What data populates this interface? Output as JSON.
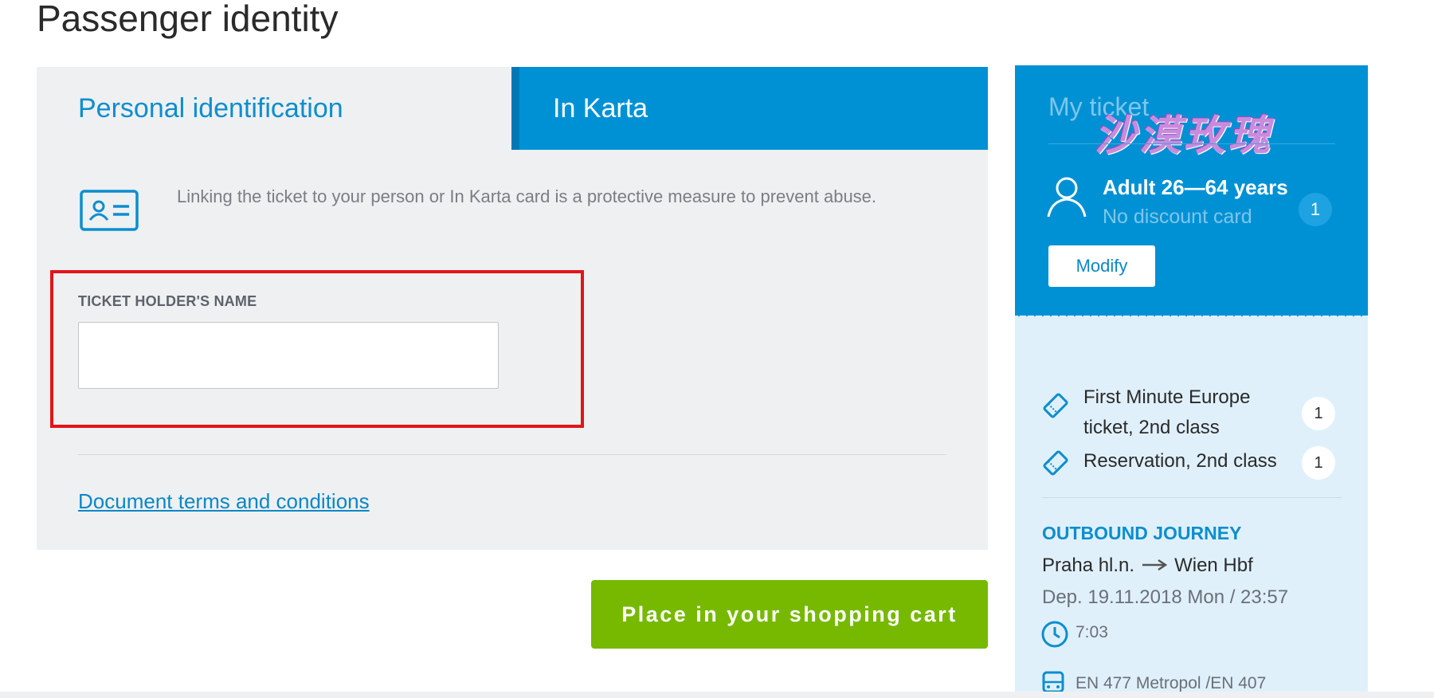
{
  "page": {
    "title": "Passenger identity"
  },
  "tabs": [
    {
      "label": "Personal identification",
      "active": true
    },
    {
      "label": "In Karta",
      "active": false
    }
  ],
  "identification": {
    "info_text": "Linking the ticket to your person or In Karta card is a protective measure to prevent abuse.",
    "field_label": "TICKET HOLDER'S NAME",
    "field_value": "",
    "terms_link": "Document terms and conditions"
  },
  "actions": {
    "cart_button": "Place in your shopping cart"
  },
  "my_ticket": {
    "title": "My ticket",
    "watermark": "沙漠玫瑰",
    "passenger_type": "Adult 26—64 years",
    "discount_card": "No discount card",
    "passenger_count": "1",
    "modify_button": "Modify",
    "items": [
      {
        "line1": "First Minute Europe",
        "line2": "ticket, 2nd class",
        "count": "1"
      },
      {
        "line1": "Reservation, 2nd class",
        "count": "1"
      }
    ],
    "outbound": {
      "title": "OUTBOUND JOURNEY",
      "from": "Praha hl.n.",
      "to": "Wien Hbf",
      "departure": "Dep. 19.11.2018 Mon / 23:57",
      "duration": "7:03",
      "train": "EN 477 Metropol /EN 407"
    }
  },
  "colors": {
    "accent_blue": "#0091d5",
    "link_blue": "#0a87c6",
    "cart_green": "#76b900",
    "highlight_red": "#e3141a",
    "panel_gray": "#eff0f2",
    "sidebar_light_blue": "#e0f0fb"
  },
  "icons": {
    "id_card": "id-card-icon",
    "person": "person-icon",
    "ticket": "ticket-icon",
    "clock": "clock-icon",
    "train": "train-icon",
    "arrow": "arrow-right-icon"
  }
}
